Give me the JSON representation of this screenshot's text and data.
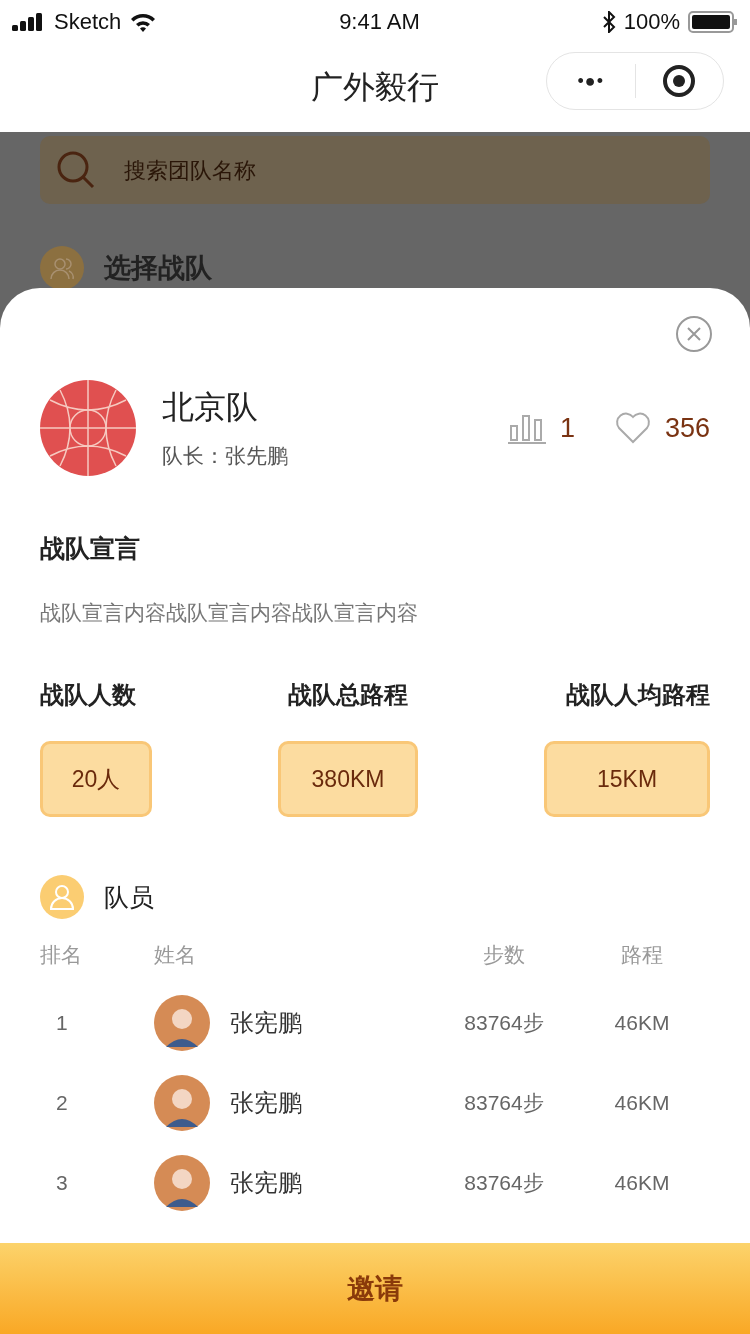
{
  "status_bar": {
    "carrier": "Sketch",
    "time": "9:41 AM",
    "battery": "100%"
  },
  "nav": {
    "title": "广外毅行",
    "more": "•●•"
  },
  "background": {
    "search": {
      "placeholder": "搜索团队名称"
    },
    "section_title": "选择战队"
  },
  "team": {
    "name": "北京队",
    "captain": "队长：张先鹏",
    "rank": "1",
    "likes": "356",
    "liked": false
  },
  "declaration": {
    "title": "战队宣言",
    "text": "战队宣言内容战队宣言内容战队宣言内容"
  },
  "stats": [
    {
      "label": "战队人数",
      "value": "20人"
    },
    {
      "label": "战队总路程",
      "value": "380KM"
    },
    {
      "label": "战队人均路程",
      "value": "15KM"
    }
  ],
  "members_title": "队员",
  "columns": [
    "排名",
    "姓名",
    "步数",
    "路程"
  ],
  "members": [
    {
      "rank": "1",
      "name": "张宪鹏",
      "steps": "83764步",
      "distance": "46KM"
    },
    {
      "rank": "2",
      "name": "张宪鹏",
      "steps": "83764步",
      "distance": "46KM"
    },
    {
      "rank": "3",
      "name": "张宪鹏",
      "steps": "83764步",
      "distance": "46KM"
    }
  ],
  "invite_button": "邀请"
}
